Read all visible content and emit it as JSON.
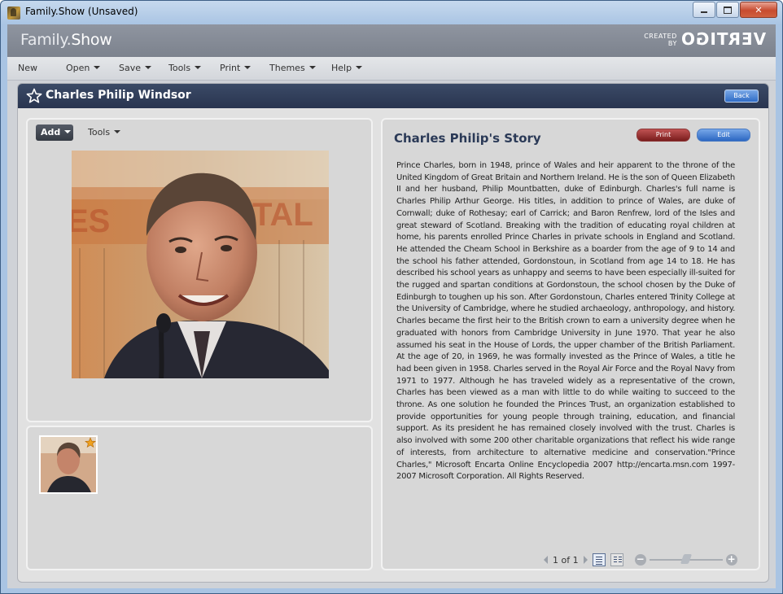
{
  "window": {
    "title": "Family.Show (Unsaved)"
  },
  "header": {
    "brand_left": "Family.",
    "brand_right": "Show",
    "created_by_line1": "CREATED",
    "created_by_line2": "BY",
    "vertigo": "VERTIGO"
  },
  "menu": {
    "items": [
      {
        "label": "New",
        "dropdown": false
      },
      {
        "label": "Open",
        "dropdown": true
      },
      {
        "label": "Save",
        "dropdown": true
      },
      {
        "label": "Tools",
        "dropdown": true
      },
      {
        "label": "Print",
        "dropdown": true
      },
      {
        "label": "Themes",
        "dropdown": true
      },
      {
        "label": "Help",
        "dropdown": true
      }
    ]
  },
  "person": {
    "name": "Charles Philip Windsor",
    "back_label": "Back"
  },
  "photos": {
    "add_label": "Add",
    "tools_label": "Tools"
  },
  "story": {
    "title": "Charles Philip's Story",
    "print_label": "Print",
    "edit_label": "Edit",
    "text": "Prince Charles, born in 1948, prince of Wales and heir apparent to the throne of the United Kingdom of Great Britain and Northern Ireland. He is the son of Queen Elizabeth II and her husband, Philip Mountbatten, duke of Edinburgh. Charles's full name is Charles Philip Arthur George. His titles, in addition to prince of Wales, are duke of Cornwall; duke of Rothesay; earl of Carrick; and Baron Renfrew, lord of the Isles and great steward of Scotland.  Breaking with the tradition of educating royal children at home, his parents enrolled Prince Charles in private schools in England and Scotland. He attended the Cheam School in Berkshire as a boarder from the age of 9 to 14 and the school his father attended, Gordonstoun, in Scotland from age 14 to 18. He has described his school years as unhappy and seems to have been especially ill-suited for the rugged and spartan conditions at Gordonstoun, the school chosen by the Duke of Edinburgh to toughen up his son. After Gordonstoun, Charles entered Trinity College at the University of Cambridge, where he studied archaeology, anthropology, and history. Charles became the first heir to the British crown to earn a university degree when he graduated with honors from Cambridge University in June 1970. That year he also assumed his seat in the House of Lords, the upper chamber of the British Parliament. At the age of 20, in 1969, he was formally invested as the Prince of Wales, a title he had been given in 1958. Charles served in the Royal Air Force and the Royal Navy from 1971 to 1977. Although he has traveled widely as a representative of the crown, Charles has been viewed as a man with little to do while waiting to succeed to the throne. As one solution he founded the Princes Trust, an organization established to provide opportunities for young people through training, education, and financial support. As its president he has remained closely involved with the trust. Charles is also involved with some 200 other charitable organizations that reflect his wide range of interests, from architecture to alternative medicine and conservation.\"Prince Charles,\" Microsoft Encarta Online Encyclopedia 2007 http://encarta.msn.com  1997-2007 Microsoft Corporation. All Rights Reserved.",
    "page_indicator": "1 of 1",
    "zoom_level": 0.5
  }
}
